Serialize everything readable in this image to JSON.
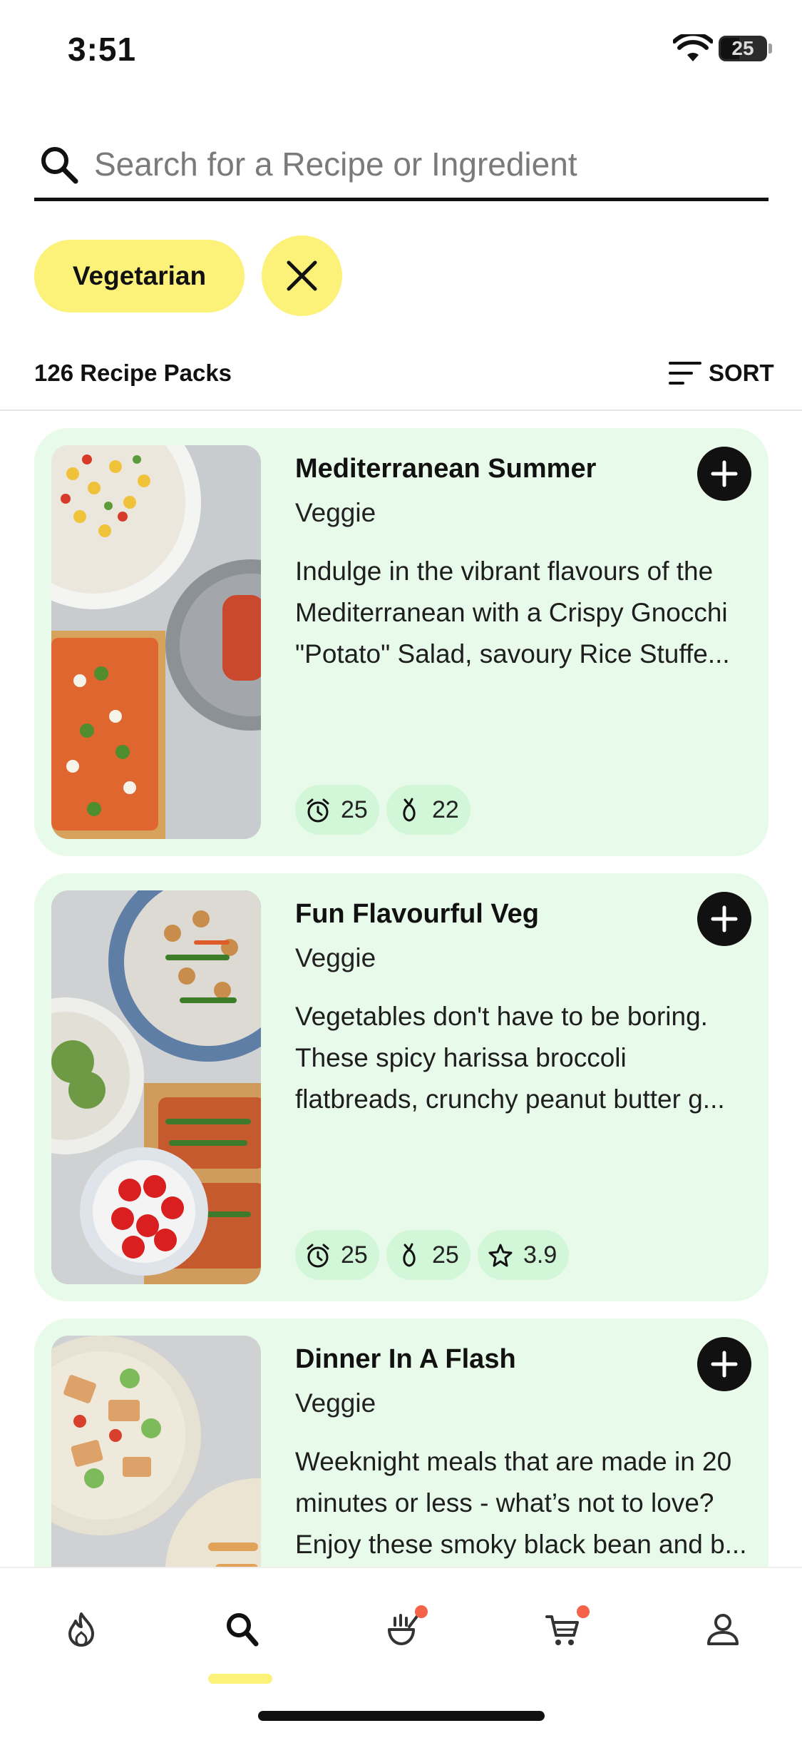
{
  "status": {
    "time": "3:51",
    "battery": "25"
  },
  "search": {
    "placeholder": "Search for a Recipe or Ingredient"
  },
  "filters": {
    "active": [
      "Vegetarian"
    ]
  },
  "results": {
    "count_label": "126 Recipe Packs",
    "sort_label": "SORT"
  },
  "cards": [
    {
      "title": "Mediterranean Summer",
      "category": "Veggie",
      "description_lines": [
        "Indulge in the vibrant flavours of the",
        "Mediterranean with a Crispy Gnocchi",
        "\"Potato\" Salad, savoury Rice Stuffe..."
      ],
      "time": "25",
      "ingredients": "22"
    },
    {
      "title": "Fun Flavourful Veg",
      "category": "Veggie",
      "description_lines": [
        "Vegetables don't have to be boring.",
        "These spicy harissa broccoli",
        "flatbreads, crunchy peanut butter g..."
      ],
      "time": "25",
      "ingredients": "25",
      "rating": "3.9"
    },
    {
      "title": "Dinner In A Flash",
      "category": "Veggie",
      "description_lines": [
        "Weeknight meals that are made in 20",
        "minutes or less - what’s not to love?",
        "Enjoy these smoky black bean and b..."
      ]
    }
  ],
  "nav": {
    "tabs": [
      "flame-icon",
      "search-icon",
      "cooking-icon",
      "cart-icon",
      "profile-icon"
    ],
    "active_tab": "search-icon",
    "notification_dots": [
      "cooking-icon",
      "cart-icon"
    ]
  },
  "colors": {
    "accent": "#fcf27a",
    "card_bg": "#e8faea",
    "chip_bg": "#d2f6d8",
    "badge": "#f4624a"
  }
}
